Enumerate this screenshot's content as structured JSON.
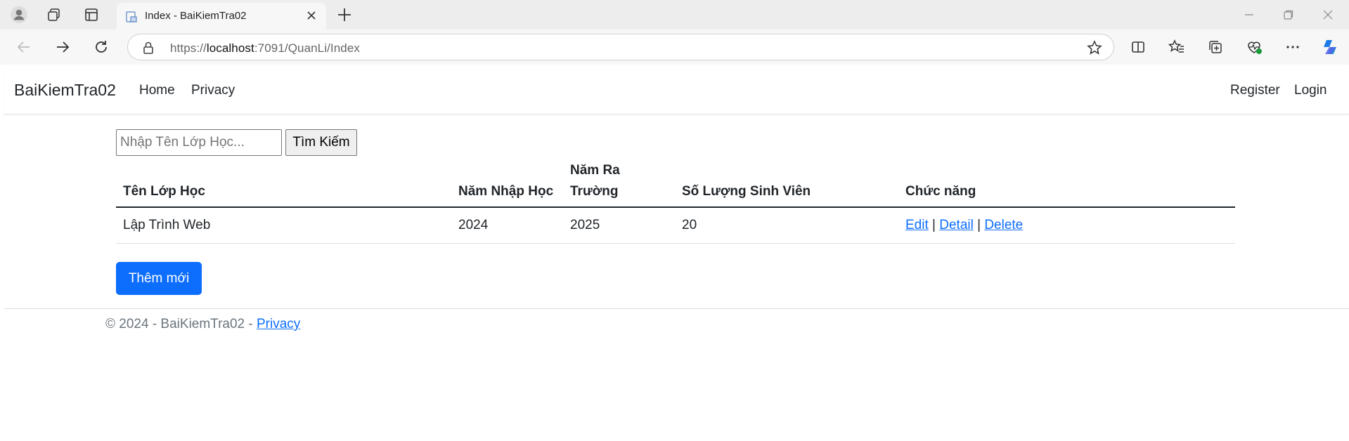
{
  "browser": {
    "tab_title": "Index - BaiKiemTra02",
    "url_prefix": "https://",
    "url_host": "localhost",
    "url_path": ":7091/QuanLi/Index"
  },
  "navbar": {
    "brand": "BaiKiemTra02",
    "links": [
      "Home",
      "Privacy"
    ],
    "right_links": [
      "Register",
      "Login"
    ]
  },
  "search": {
    "placeholder": "Nhập Tên Lớp Học...",
    "button_label": "Tìm Kiếm"
  },
  "table": {
    "headers": [
      "Tên Lớp Học",
      "Năm Nhập Học",
      "Năm Ra Trường",
      "Số Lượng Sinh Viên",
      "Chức năng"
    ],
    "rows": [
      {
        "ten_lop": "Lập Trình Web",
        "nam_nhap": "2024",
        "nam_ra": "2025",
        "so_luong": "20",
        "actions": [
          "Edit",
          "Detail",
          "Delete"
        ]
      }
    ]
  },
  "add_button": "Thêm mới",
  "footer": {
    "text": "© 2024 - BaiKiemTra02 - ",
    "link": "Privacy"
  },
  "colors": {
    "primary": "#0d6efd",
    "text": "#212529",
    "muted": "#6c757d"
  }
}
